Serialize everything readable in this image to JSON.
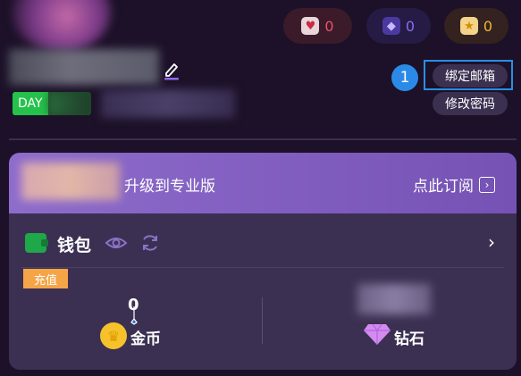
{
  "stats": {
    "likes": "0",
    "gems": "0",
    "stars": "0"
  },
  "profile": {
    "day_label": "DAY"
  },
  "actions": {
    "step_number": "1",
    "bind_email": "绑定邮箱",
    "change_password": "修改密码"
  },
  "upgrade": {
    "text": "升级到专业版",
    "subscribe": "点此订阅"
  },
  "wallet": {
    "title": "钱包",
    "recharge": "充值",
    "gold_value": "0",
    "gold_label": "金币",
    "diamond_label": "钻石"
  },
  "icons": [
    "edit-icon",
    "heart-icon",
    "gem-icon",
    "star-icon",
    "wallet-icon",
    "eye-icon",
    "refresh-icon",
    "chevron-right-icon",
    "coin-icon",
    "diamond-icon",
    "cursor-icon"
  ],
  "colors": {
    "background": "#1c1128",
    "card": "#3c3052",
    "upgrade_gradient_start": "#8e6ccc",
    "accent_blue": "#2b8ae8",
    "recharge_orange": "#f5a547",
    "wallet_green": "#1fa84a",
    "heart_red": "#e8536b",
    "gem_purple": "#8d6cf0",
    "star_gold": "#f3b534"
  }
}
